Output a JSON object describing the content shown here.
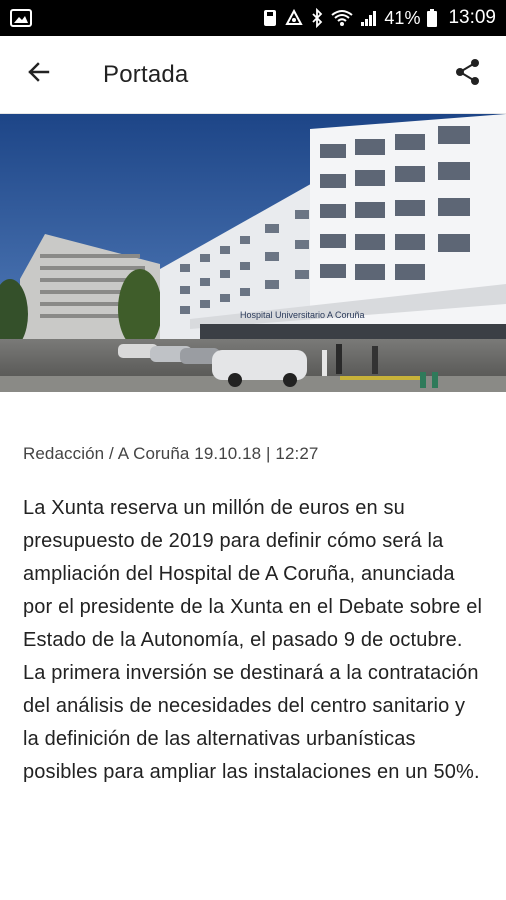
{
  "status_bar": {
    "battery_percent": "41%",
    "time": "13:09",
    "icons": [
      "image-icon",
      "save-icon",
      "nfc-icon",
      "bluetooth-icon",
      "wifi-icon",
      "signal-icon",
      "battery-icon"
    ]
  },
  "app_bar": {
    "title": "Portada",
    "back_icon": "arrow-back-icon",
    "share_icon": "share-icon"
  },
  "hero": {
    "sign_text": "Hospital Universitario A Coruña"
  },
  "article": {
    "byline": "Redacción / A Coruña 19.10.18 | 12:27",
    "body": "La Xunta reserva un millón de euros en su presupuesto de 2019 para definir cómo será la ampliación del Hospital de A Coruña, anunciada por el presidente de la Xunta en el Debate sobre el Estado de la Autonomía, el pasado 9 de octubre. La primera inversión se destinará a la contratación del análisis de necesidades del centro sanitario y la definición de las alternativas urbanísticas posibles para ampliar las instalaciones en un 50%."
  },
  "colors": {
    "status_bar_bg": "#000000",
    "app_bar_bg": "#ffffff",
    "text": "#222222",
    "sky": "#2a4f8a"
  }
}
